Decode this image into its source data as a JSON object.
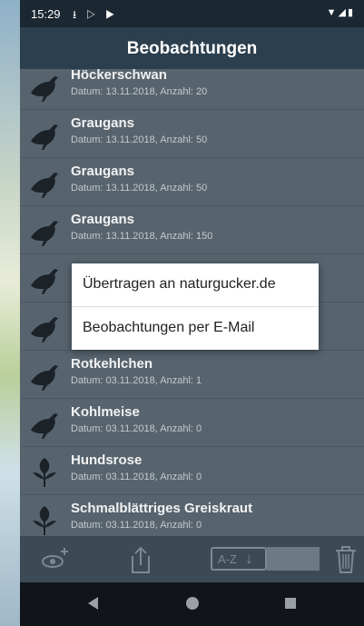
{
  "status_bar": {
    "time": "15:29",
    "left_icons": "⭳ ▷ ▶",
    "right_icons": "▼◢▮"
  },
  "app_bar": {
    "title": "Beobachtungen"
  },
  "observations": [
    {
      "name": "Höckerschwan",
      "meta": "Datum: 13.11.2018, Anzahl: 20",
      "icon": "bird-icon"
    },
    {
      "name": "Graugans",
      "meta": "Datum: 13.11.2018, Anzahl: 50",
      "icon": "bird-icon"
    },
    {
      "name": "Graugans",
      "meta": "Datum: 13.11.2018, Anzahl: 50",
      "icon": "bird-icon"
    },
    {
      "name": "Graugans",
      "meta": "Datum: 13.11.2018, Anzahl: 150",
      "icon": "bird-icon"
    },
    {
      "name": "",
      "meta": "",
      "icon": "bird-icon"
    },
    {
      "name": "",
      "meta": "",
      "icon": "bird-icon"
    },
    {
      "name": "Rotkehlchen",
      "meta": "Datum: 03.11.2018, Anzahl: 1",
      "icon": "bird-icon"
    },
    {
      "name": "Kohlmeise",
      "meta": "Datum: 03.11.2018, Anzahl: 0",
      "icon": "bird-icon"
    },
    {
      "name": "Hundsrose",
      "meta": "Datum: 03.11.2018, Anzahl: 0",
      "icon": "plant-icon"
    },
    {
      "name": "Schmalblättriges Greiskraut",
      "meta": "Datum: 03.11.2018, Anzahl: 0",
      "icon": "plant-icon"
    }
  ],
  "dialog": {
    "option_1": "Übertragen an naturgucker.de",
    "option_2": "Beobachtungen per E-Mail"
  },
  "toolbar": {
    "add_icon": "add-observation-icon",
    "share_icon": "share-icon",
    "sort_label": "A-Z",
    "delete_icon": "trash-icon"
  },
  "colors": {
    "app_bar": "#2c3f4e",
    "list_background": "#57646e",
    "dialog": "#ffffff"
  }
}
